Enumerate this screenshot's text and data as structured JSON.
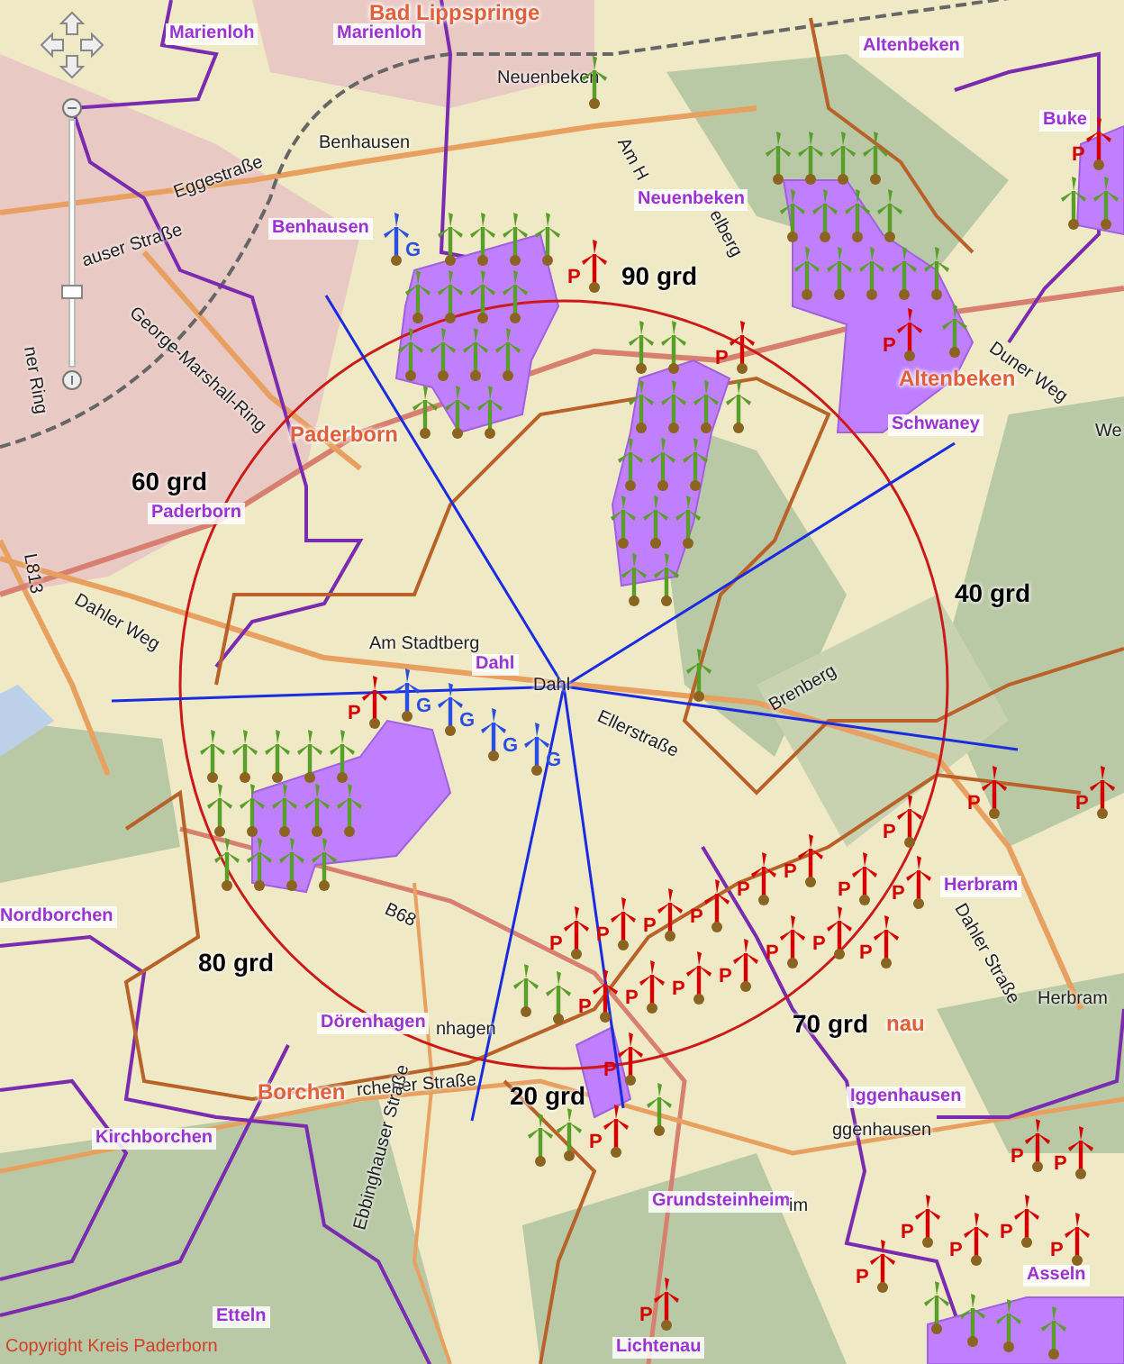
{
  "map_controls": {
    "zoom_slider": {
      "level": 0.3
    }
  },
  "place_labels": [
    {
      "text": "Bad Lippspringe",
      "kind": "town"
    },
    {
      "text": "Marienloh",
      "kind": "district"
    },
    {
      "text": "Marienloh",
      "kind": "district"
    },
    {
      "text": "Neuenbeken",
      "kind": "street"
    },
    {
      "text": "Altenbeken",
      "kind": "district"
    },
    {
      "text": "Benhausen",
      "kind": "street"
    },
    {
      "text": "Eggestraße",
      "kind": "street"
    },
    {
      "text": "auser Straße",
      "kind": "street"
    },
    {
      "text": "Benhausen",
      "kind": "district"
    },
    {
      "text": "George-Marshall-Ring",
      "kind": "street"
    },
    {
      "text": "Am H",
      "kind": "street"
    },
    {
      "text": "elberg",
      "kind": "street"
    },
    {
      "text": "Neuenbeken",
      "kind": "district"
    },
    {
      "text": "Buke",
      "kind": "district"
    },
    {
      "text": "ner Ring",
      "kind": "street"
    },
    {
      "text": "Paderborn",
      "kind": "town"
    },
    {
      "text": "Altenbeken",
      "kind": "town"
    },
    {
      "text": "Schwaney",
      "kind": "district"
    },
    {
      "text": "Duner Weg",
      "kind": "street"
    },
    {
      "text": "We",
      "kind": "street"
    },
    {
      "text": "Paderborn",
      "kind": "district"
    },
    {
      "text": "L813",
      "kind": "street"
    },
    {
      "text": "Dahler Weg",
      "kind": "street"
    },
    {
      "text": "Am Stadtberg",
      "kind": "street"
    },
    {
      "text": "Dahl",
      "kind": "district"
    },
    {
      "text": "Dahl",
      "kind": "street"
    },
    {
      "text": "Ellerstraße",
      "kind": "street"
    },
    {
      "text": "Brenberg",
      "kind": "street"
    },
    {
      "text": "B68",
      "kind": "street"
    },
    {
      "text": "Herbram",
      "kind": "district"
    },
    {
      "text": "Dahler Straße",
      "kind": "street"
    },
    {
      "text": "Nordborchen",
      "kind": "district"
    },
    {
      "text": "Herbram",
      "kind": "street"
    },
    {
      "text": "Dörenhagen",
      "kind": "district"
    },
    {
      "text": "nhagen",
      "kind": "street"
    },
    {
      "text": "nau",
      "kind": "town"
    },
    {
      "text": "Borchen",
      "kind": "town"
    },
    {
      "text": "rchener Straße",
      "kind": "street"
    },
    {
      "text": "Iggenhausen",
      "kind": "district"
    },
    {
      "text": "ggenhausen",
      "kind": "street"
    },
    {
      "text": "Kirchborchen",
      "kind": "district"
    },
    {
      "text": "Ebbinghauser Straße",
      "kind": "street"
    },
    {
      "text": "Grundsteinheim",
      "kind": "district"
    },
    {
      "text": "im",
      "kind": "street"
    },
    {
      "text": "Asseln",
      "kind": "district"
    },
    {
      "text": "Etteln",
      "kind": "district"
    },
    {
      "text": "Lichtenau",
      "kind": "district"
    }
  ],
  "sector_labels": [
    "90 grd",
    "60 grd",
    "40 grd",
    "80 grd",
    "70 grd",
    "20 grd"
  ],
  "turbines": [
    {
      "kind": "existing"
    },
    {
      "kind": "existing"
    },
    {
      "kind": "existing"
    },
    {
      "kind": "existing"
    },
    {
      "kind": "existing"
    },
    {
      "kind": "existing"
    },
    {
      "kind": "existing"
    },
    {
      "kind": "existing"
    },
    {
      "kind": "existing"
    },
    {
      "kind": "existing"
    },
    {
      "kind": "existing"
    },
    {
      "kind": "existing"
    },
    {
      "kind": "existing"
    },
    {
      "kind": "existing"
    },
    {
      "kind": "existing"
    },
    {
      "kind": "existing"
    },
    {
      "kind": "existing"
    },
    {
      "kind": "existing"
    },
    {
      "kind": "existing"
    },
    {
      "kind": "existing"
    },
    {
      "kind": "existing"
    },
    {
      "kind": "existing"
    },
    {
      "kind": "existing"
    },
    {
      "kind": "existing"
    },
    {
      "kind": "existing"
    },
    {
      "kind": "existing"
    },
    {
      "kind": "existing"
    },
    {
      "kind": "existing"
    },
    {
      "kind": "existing"
    },
    {
      "kind": "existing"
    },
    {
      "kind": "existing"
    },
    {
      "kind": "existing"
    },
    {
      "kind": "existing"
    },
    {
      "kind": "existing"
    },
    {
      "kind": "existing"
    },
    {
      "kind": "existing"
    },
    {
      "kind": "existing"
    },
    {
      "kind": "existing"
    },
    {
      "kind": "existing"
    },
    {
      "kind": "existing"
    },
    {
      "kind": "existing"
    },
    {
      "kind": "existing"
    },
    {
      "kind": "existing"
    },
    {
      "kind": "existing"
    },
    {
      "kind": "existing"
    },
    {
      "kind": "existing"
    },
    {
      "kind": "existing"
    },
    {
      "kind": "existing"
    },
    {
      "kind": "existing"
    },
    {
      "kind": "existing"
    },
    {
      "kind": "existing"
    },
    {
      "kind": "existing"
    },
    {
      "kind": "existing"
    },
    {
      "kind": "existing"
    },
    {
      "kind": "existing"
    },
    {
      "kind": "existing"
    },
    {
      "kind": "existing"
    },
    {
      "kind": "existing"
    },
    {
      "kind": "existing"
    },
    {
      "kind": "existing"
    },
    {
      "kind": "existing"
    },
    {
      "kind": "existing"
    },
    {
      "kind": "existing"
    },
    {
      "kind": "existing"
    },
    {
      "kind": "existing"
    },
    {
      "kind": "existing"
    },
    {
      "kind": "existing"
    },
    {
      "kind": "existing"
    },
    {
      "kind": "existing"
    },
    {
      "kind": "existing"
    },
    {
      "kind": "planned",
      "label": "P"
    },
    {
      "kind": "planned",
      "label": "P"
    },
    {
      "kind": "planned",
      "label": "P"
    },
    {
      "kind": "planned",
      "label": "P"
    },
    {
      "kind": "planned",
      "label": "P"
    },
    {
      "kind": "planned",
      "label": "P"
    },
    {
      "kind": "planned",
      "label": "P"
    },
    {
      "kind": "planned",
      "label": "P"
    },
    {
      "kind": "planned",
      "label": "P"
    },
    {
      "kind": "planned",
      "label": "P"
    },
    {
      "kind": "planned",
      "label": "P"
    },
    {
      "kind": "planned",
      "label": "P"
    },
    {
      "kind": "planned",
      "label": "P"
    },
    {
      "kind": "planned",
      "label": "P"
    },
    {
      "kind": "planned",
      "label": "P"
    },
    {
      "kind": "planned",
      "label": "P"
    },
    {
      "kind": "planned",
      "label": "P"
    },
    {
      "kind": "planned",
      "label": "P"
    },
    {
      "kind": "planned",
      "label": "P"
    },
    {
      "kind": "planned",
      "label": "P"
    },
    {
      "kind": "planned",
      "label": "P"
    },
    {
      "kind": "planned",
      "label": "P"
    },
    {
      "kind": "planned",
      "label": "P"
    },
    {
      "kind": "planned",
      "label": "P"
    },
    {
      "kind": "planned",
      "label": "P"
    },
    {
      "kind": "planned",
      "label": "P"
    },
    {
      "kind": "planned",
      "label": "P"
    },
    {
      "kind": "planned",
      "label": "P"
    },
    {
      "kind": "planned",
      "label": "P"
    },
    {
      "kind": "planned",
      "label": "P"
    },
    {
      "kind": "planned",
      "label": "P"
    },
    {
      "kind": "planned",
      "label": "P"
    },
    {
      "kind": "planned",
      "label": "P"
    },
    {
      "kind": "approved",
      "label": "G"
    },
    {
      "kind": "approved",
      "label": "G"
    },
    {
      "kind": "approved",
      "label": "G"
    },
    {
      "kind": "approved",
      "label": "G"
    },
    {
      "kind": "approved",
      "label": "G"
    }
  ],
  "copyright": "Copyright Kreis Paderborn"
}
